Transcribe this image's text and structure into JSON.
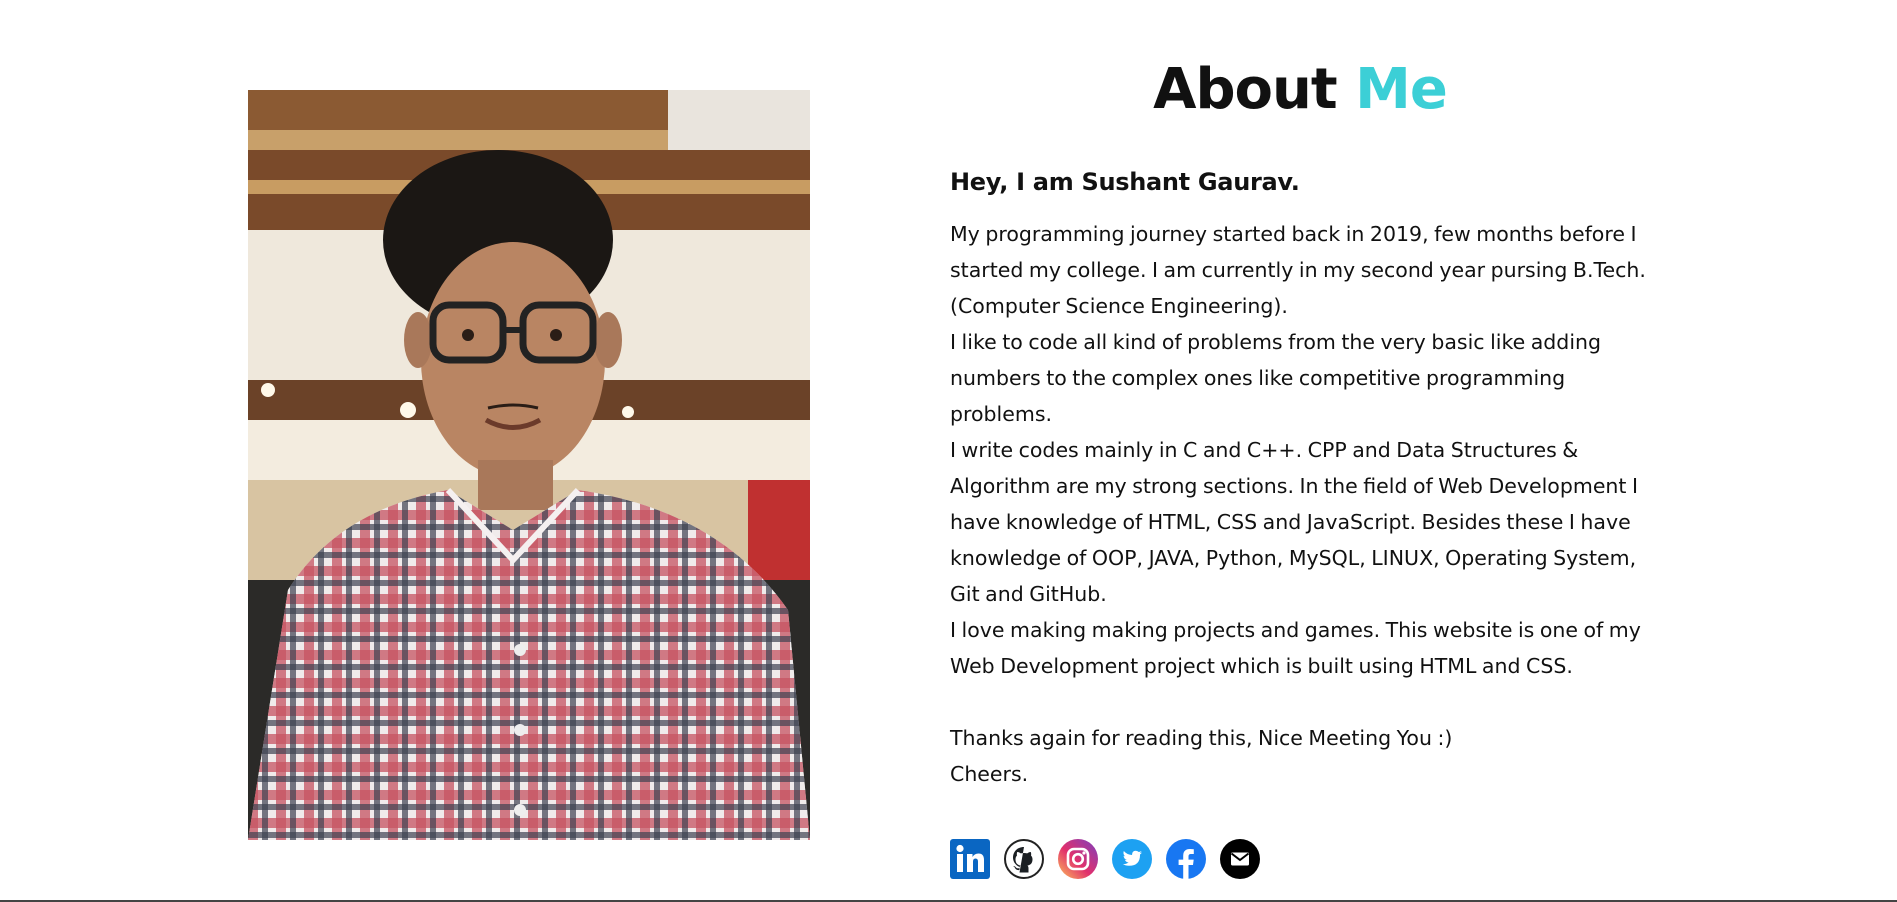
{
  "colors": {
    "accent": "#3ccfd6"
  },
  "about": {
    "title_plain": "About",
    "title_accent": "Me",
    "greeting": "Hey, I am Sushant Gaurav.",
    "paragraphs": [
      "My programming journey started back in 2019, few months before I started my college. I am currently in my second year pursing B.Tech. (Computer Science Engineering).",
      "I like to code all kind of problems from the very basic like adding numbers to the complex ones like competitive programming problems.",
      "I write codes mainly in C and C++. CPP and Data Structures & Algorithm are my strong sections. In the field of Web Development I have knowledge of HTML, CSS and JavaScript. Besides these I have knowledge of OOP, JAVA, Python, MySQL, LINUX, Operating System, Git and GitHub.",
      "I love making making projects and games. This website is one of my Web Development project which is built using HTML and CSS."
    ],
    "closing": "Thanks again for reading this, Nice Meeting You :)",
    "signoff": "Cheers."
  },
  "socials": [
    {
      "icon": "linkedin-icon"
    },
    {
      "icon": "github-icon"
    },
    {
      "icon": "instagram-icon"
    },
    {
      "icon": "twitter-icon"
    },
    {
      "icon": "facebook-icon"
    },
    {
      "icon": "email-icon"
    }
  ]
}
